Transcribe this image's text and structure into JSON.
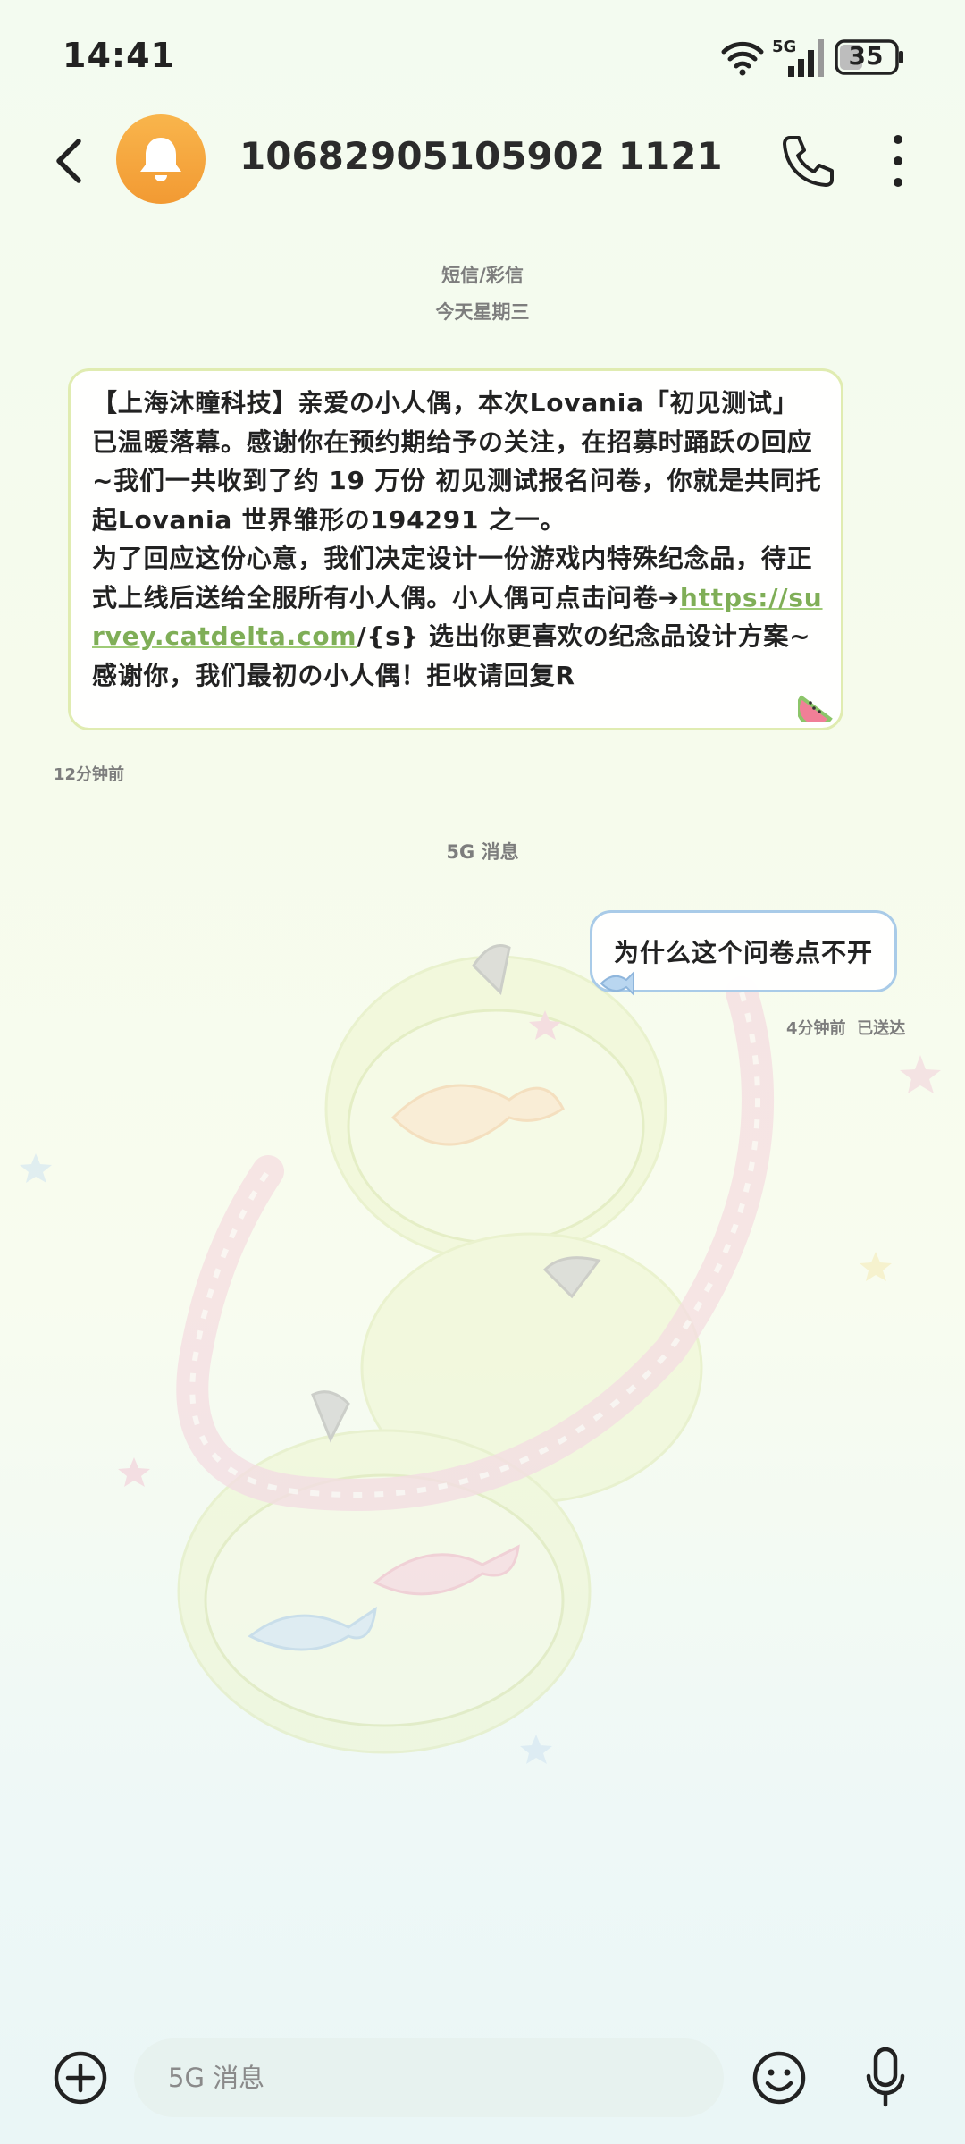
{
  "status_bar": {
    "time": "14:41",
    "network": "5G",
    "battery": "35",
    "icons": [
      "wifi-icon",
      "signal-icon",
      "battery-icon"
    ]
  },
  "header": {
    "contact_number": "10682905105902 1121",
    "contact_number_exact": "10682905105902 1121",
    "avatar_icon": "bell-icon",
    "avatar_color": "#f4a13c"
  },
  "conversation": {
    "message_type": "短信/彩信",
    "date_label": "今天星期三",
    "incoming": {
      "line1": "【上海沐瞳科技】亲爱の小人偶，本次Lovania「初见测试」已温暖落幕。感谢你在预约期给予の关注，在招募时踊跃の回应~我们一共收到了约 19 万份 初见测试报名问卷，你就是共同托起Lovania 世界雏形の194291 之一。",
      "line2_prefix": "为了回应这份心意，我们决定设计一份游戏内特殊纪念品，待正式上线后送给全服所有小人偶。小人偶可点击问卷➔",
      "link": "https://survey.catdelta.com",
      "line2_suffix": "/{s} 选出你更喜欢の纪念品设计方案~",
      "line3": "感谢你，我们最初の小人偶！拒收请回复R",
      "time": "12分钟前"
    },
    "channel_label": "5G 消息",
    "outgoing": {
      "text": "为什么这个问卷点不开",
      "time": "4分钟前",
      "status": "已送达"
    }
  },
  "input_bar": {
    "placeholder": "5G 消息"
  },
  "colors": {
    "incoming_border": "#e0ecb1",
    "outgoing_border": "#a9cbe8",
    "link": "#7fae57"
  }
}
